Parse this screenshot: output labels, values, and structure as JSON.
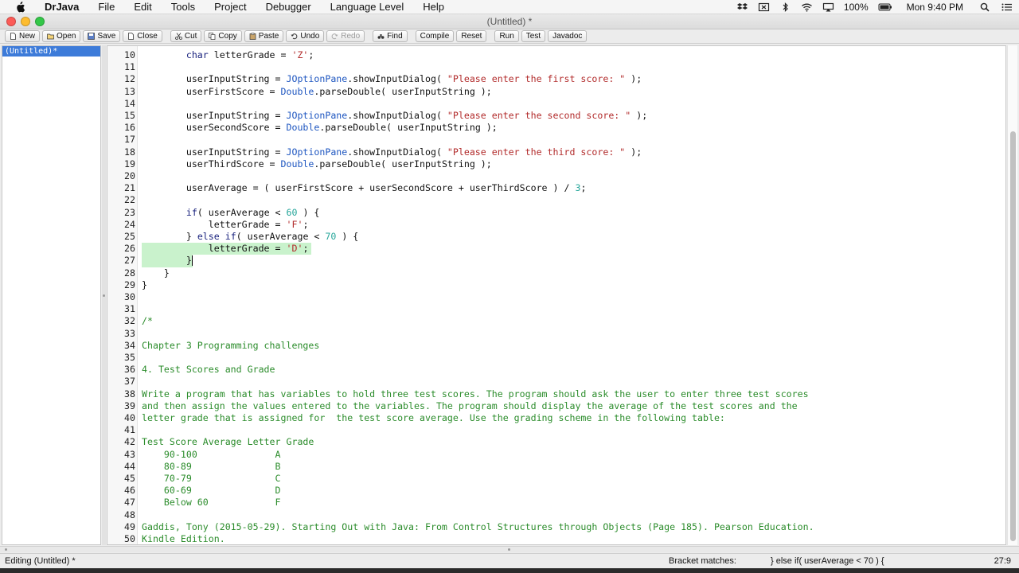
{
  "menubar": {
    "app_name": "DrJava",
    "items": [
      "File",
      "Edit",
      "Tools",
      "Project",
      "Debugger",
      "Language Level",
      "Help"
    ],
    "battery": "100%",
    "clock": "Mon 9:40 PM"
  },
  "window": {
    "title": "(Untitled) *"
  },
  "toolbar": {
    "new": "New",
    "open": "Open",
    "save": "Save",
    "close": "Close",
    "cut": "Cut",
    "copy": "Copy",
    "paste": "Paste",
    "undo": "Undo",
    "redo": "Redo",
    "find": "Find",
    "compile": "Compile",
    "reset": "Reset",
    "run": "Run",
    "test": "Test",
    "javadoc": "Javadoc"
  },
  "documents": {
    "items": [
      "(Untitled)*"
    ]
  },
  "editor": {
    "lines": [
      {
        "n": "10",
        "t": [
          [
            "        ",
            ""
          ],
          [
            "char",
            "kw"
          ],
          [
            " letterGrade = ",
            ""
          ],
          [
            "'Z'",
            "str"
          ],
          [
            ";",
            ""
          ]
        ]
      },
      {
        "n": "11",
        "t": []
      },
      {
        "n": "12",
        "t": [
          [
            "        userInputString = ",
            ""
          ],
          [
            "JOptionPane",
            "cls"
          ],
          [
            ".showInputDialog( ",
            ""
          ],
          [
            "\"Please enter the first score: \"",
            "str"
          ],
          [
            " );",
            ""
          ]
        ]
      },
      {
        "n": "13",
        "t": [
          [
            "        userFirstScore = ",
            ""
          ],
          [
            "Double",
            "cls"
          ],
          [
            ".parseDouble( userInputString );",
            ""
          ]
        ]
      },
      {
        "n": "14",
        "t": []
      },
      {
        "n": "15",
        "t": [
          [
            "        userInputString = ",
            ""
          ],
          [
            "JOptionPane",
            "cls"
          ],
          [
            ".showInputDialog( ",
            ""
          ],
          [
            "\"Please enter the second score: \"",
            "str"
          ],
          [
            " );",
            ""
          ]
        ]
      },
      {
        "n": "16",
        "t": [
          [
            "        userSecondScore = ",
            ""
          ],
          [
            "Double",
            "cls"
          ],
          [
            ".parseDouble( userInputString );",
            ""
          ]
        ]
      },
      {
        "n": "17",
        "t": []
      },
      {
        "n": "18",
        "t": [
          [
            "        userInputString = ",
            ""
          ],
          [
            "JOptionPane",
            "cls"
          ],
          [
            ".showInputDialog( ",
            ""
          ],
          [
            "\"Please enter the third score: \"",
            "str"
          ],
          [
            " );",
            ""
          ]
        ]
      },
      {
        "n": "19",
        "t": [
          [
            "        userThirdScore = ",
            ""
          ],
          [
            "Double",
            "cls"
          ],
          [
            ".parseDouble( userInputString );",
            ""
          ]
        ]
      },
      {
        "n": "20",
        "t": []
      },
      {
        "n": "21",
        "t": [
          [
            "        userAverage = ( userFirstScore + userSecondScore + userThirdScore ) / ",
            ""
          ],
          [
            "3",
            "num"
          ],
          [
            ";",
            ""
          ]
        ]
      },
      {
        "n": "22",
        "t": []
      },
      {
        "n": "23",
        "t": [
          [
            "        ",
            ""
          ],
          [
            "if",
            "kw"
          ],
          [
            "( userAverage < ",
            ""
          ],
          [
            "60",
            "num"
          ],
          [
            " ) {",
            ""
          ]
        ]
      },
      {
        "n": "24",
        "t": [
          [
            "            letterGrade = ",
            ""
          ],
          [
            "'F'",
            "str"
          ],
          [
            ";",
            ""
          ]
        ]
      },
      {
        "n": "25",
        "t": [
          [
            "        } ",
            ""
          ],
          [
            "else",
            "kw"
          ],
          [
            " ",
            ""
          ],
          [
            "if",
            "kw"
          ],
          [
            "( userAverage < ",
            ""
          ],
          [
            "70",
            "num"
          ],
          [
            " ) {",
            ""
          ]
        ]
      },
      {
        "n": "26",
        "t": [
          [
            "            letterGrade = ",
            ""
          ],
          [
            "'D'",
            "str"
          ],
          [
            ";",
            ""
          ]
        ]
      },
      {
        "n": "27",
        "t": [
          [
            "        }",
            ""
          ]
        ],
        "caret": true
      },
      {
        "n": "28",
        "t": [
          [
            "    }",
            ""
          ]
        ]
      },
      {
        "n": "29",
        "t": [
          [
            "}",
            ""
          ]
        ]
      },
      {
        "n": "30",
        "t": []
      },
      {
        "n": "31",
        "t": []
      },
      {
        "n": "32",
        "t": [
          [
            "/*",
            "com"
          ]
        ]
      },
      {
        "n": "33",
        "t": []
      },
      {
        "n": "34",
        "t": [
          [
            "Chapter 3 Programming challenges",
            "com"
          ]
        ]
      },
      {
        "n": "35",
        "t": []
      },
      {
        "n": "36",
        "t": [
          [
            "4. Test Scores and Grade",
            "com"
          ]
        ]
      },
      {
        "n": "37",
        "t": []
      },
      {
        "n": "38",
        "t": [
          [
            "Write a program that has variables to hold three test scores. The program should ask the user to enter three test scores",
            "com"
          ]
        ]
      },
      {
        "n": "39",
        "t": [
          [
            "and then assign the values entered to the variables. The program should display the average of the test scores and the",
            "com"
          ]
        ]
      },
      {
        "n": "40",
        "t": [
          [
            "letter grade that is assigned for  the test score average. Use the grading scheme in the following table:",
            "com"
          ]
        ]
      },
      {
        "n": "41",
        "t": []
      },
      {
        "n": "42",
        "t": [
          [
            "Test Score Average Letter Grade",
            "com"
          ]
        ]
      },
      {
        "n": "43",
        "t": [
          [
            "    90-100              A",
            "com"
          ]
        ]
      },
      {
        "n": "44",
        "t": [
          [
            "    80-89               B",
            "com"
          ]
        ]
      },
      {
        "n": "45",
        "t": [
          [
            "    70-79               C",
            "com"
          ]
        ]
      },
      {
        "n": "46",
        "t": [
          [
            "    60-69               D",
            "com"
          ]
        ]
      },
      {
        "n": "47",
        "t": [
          [
            "    Below 60            F",
            "com"
          ]
        ]
      },
      {
        "n": "48",
        "t": []
      },
      {
        "n": "49",
        "t": [
          [
            "Gaddis, Tony (2015-05-29). Starting Out with Java: From Control Structures through Objects (Page 185). Pearson Education.",
            "com"
          ]
        ]
      },
      {
        "n": "50",
        "t": [
          [
            "Kindle Edition.",
            "com"
          ]
        ]
      }
    ]
  },
  "status": {
    "mode": "Editing (Untitled) *",
    "bracket_label": "Bracket matches:",
    "bracket_value": "} else if( userAverage < 70 ) {",
    "position": "27:9"
  },
  "colors": {
    "highlight": "#c9f2cc",
    "keyword": "#1a237e",
    "string": "#b22b2b",
    "number": "#26a69a",
    "class": "#1e56c0",
    "comment": "#2b8c2b",
    "selection": "#3d7bd9"
  }
}
